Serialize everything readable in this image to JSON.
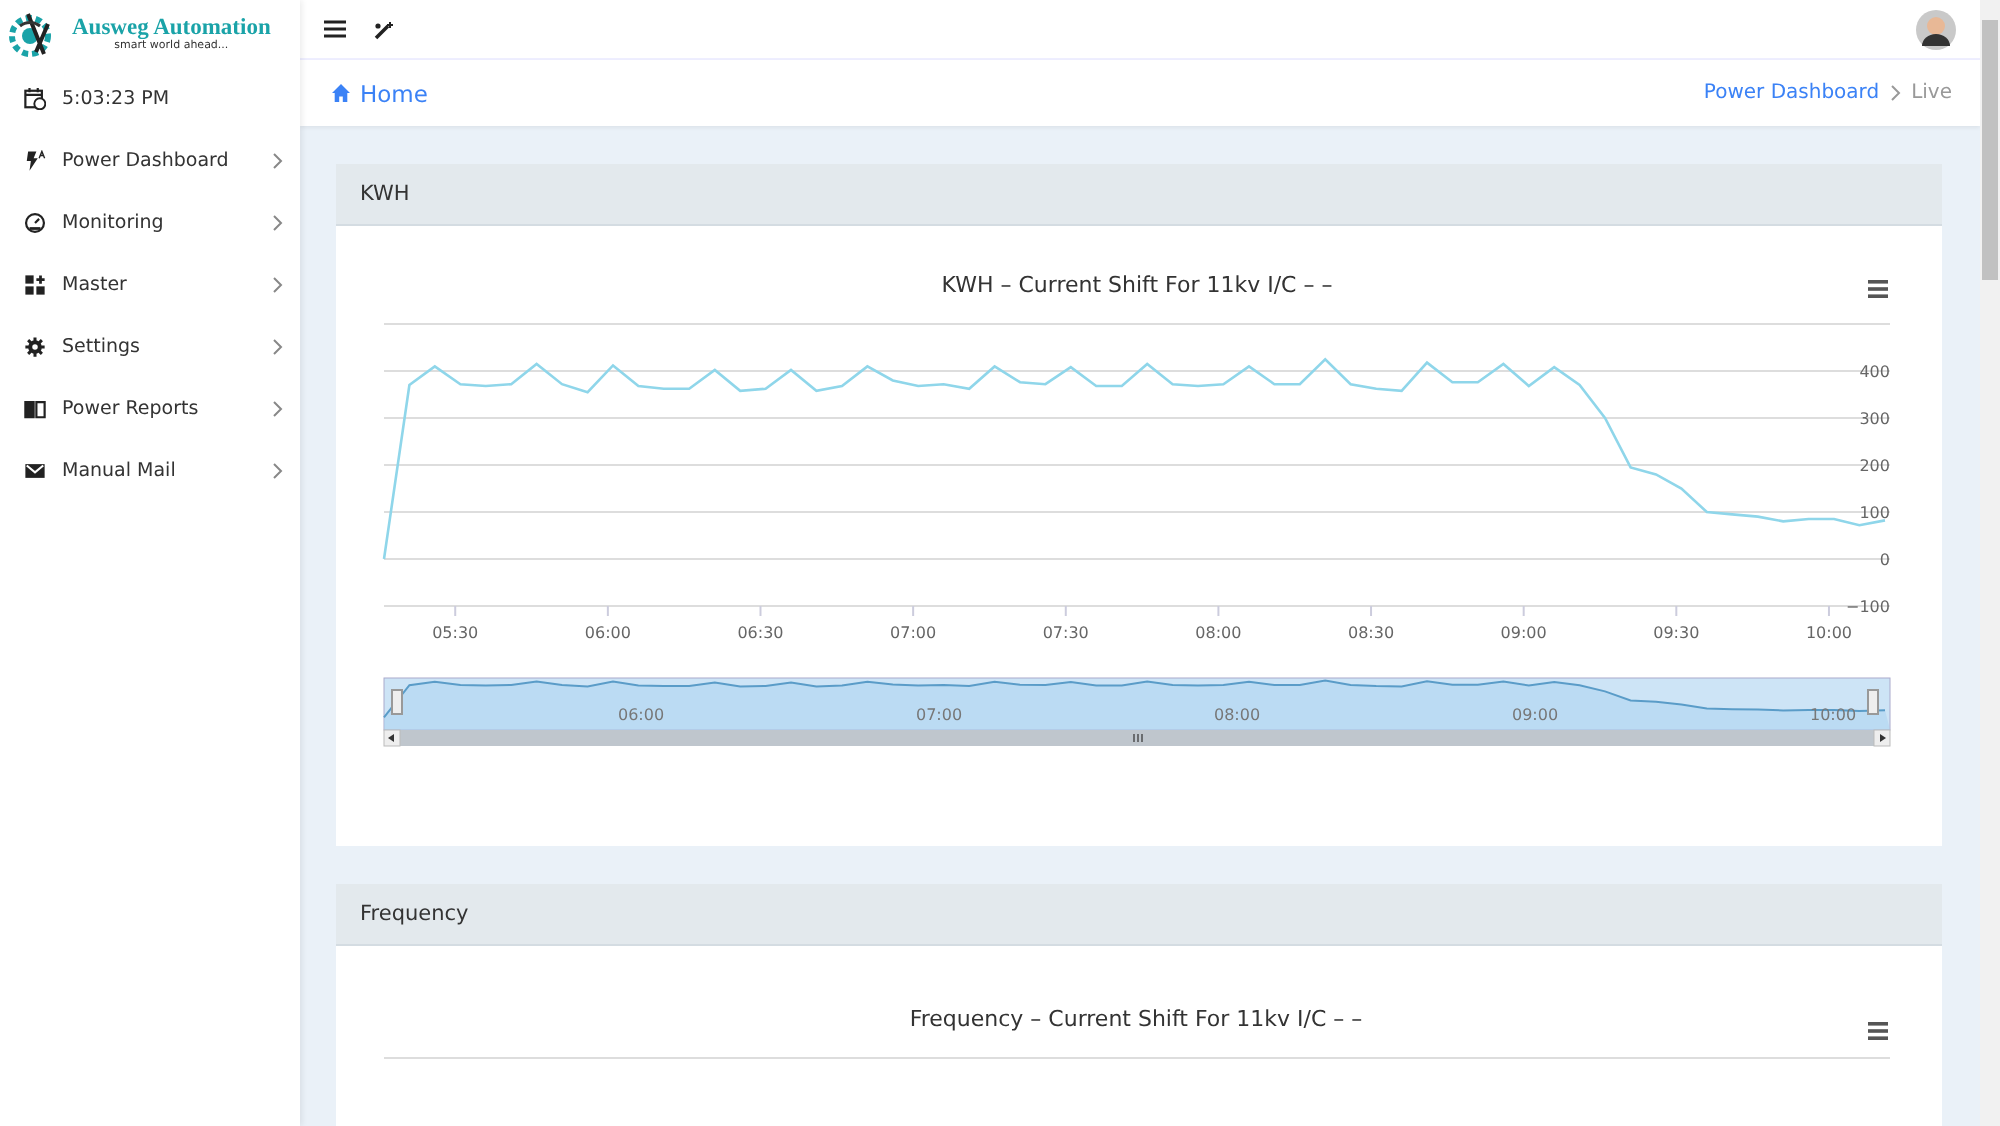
{
  "brand": {
    "name": "Ausweg Automation",
    "tagline": "smart world ahead..."
  },
  "sidebar": {
    "clock": "5:03:23 PM",
    "items": [
      {
        "label": "Power Dashboard"
      },
      {
        "label": "Monitoring"
      },
      {
        "label": "Master"
      },
      {
        "label": "Settings"
      },
      {
        "label": "Power Reports"
      },
      {
        "label": "Manual Mail"
      }
    ]
  },
  "breadcrumb": {
    "home": "Home",
    "trail": [
      "Power Dashboard",
      "Live"
    ]
  },
  "panels": [
    {
      "title": "KWH",
      "chart_data": {
        "type": "line",
        "title": "KWH – Current Shift For 11kv I/C – –",
        "x": [
          316,
          321,
          326,
          331,
          336,
          341,
          346,
          351,
          356,
          361,
          366,
          371,
          376,
          381,
          386,
          391,
          396,
          401,
          406,
          411,
          416,
          421,
          426,
          431,
          436,
          441,
          446,
          451,
          456,
          461,
          466,
          471,
          476,
          481,
          486,
          491,
          496,
          501,
          506,
          511,
          516,
          521,
          526,
          531,
          536,
          541,
          546,
          551,
          556,
          561,
          566,
          571,
          576,
          581,
          586,
          591,
          596,
          601,
          606,
          611
        ],
        "grid": true,
        "series": [
          {
            "color": "#8fd6ea",
            "values": [
              0,
              370,
              410,
              372,
              368,
              372,
              415,
              372,
              355,
              412,
              368,
              362,
              362,
              402,
              358,
              362,
              402,
              358,
              368,
              410,
              380,
              368,
              372,
              362,
              410,
              376,
              372,
              408,
              368,
              368,
              415,
              372,
              368,
              372,
              410,
              372,
              372,
              425,
              372,
              362,
              358,
              418,
              376,
              376,
              415,
              368,
              408,
              370,
              300,
              195,
              180,
              150,
              100,
              95,
              90,
              80,
              85,
              85,
              72,
              82
            ]
          }
        ],
        "xlim": [
          316,
          612
        ],
        "ylim": [
          -100,
          500
        ],
        "xticks": [
          {
            "value": 330,
            "label": "05:30"
          },
          {
            "value": 360,
            "label": "06:00"
          },
          {
            "value": 390,
            "label": "06:30"
          },
          {
            "value": 420,
            "label": "07:00"
          },
          {
            "value": 450,
            "label": "07:30"
          },
          {
            "value": 480,
            "label": "08:00"
          },
          {
            "value": 510,
            "label": "08:30"
          },
          {
            "value": 540,
            "label": "09:00"
          },
          {
            "value": 570,
            "label": "09:30"
          },
          {
            "value": 600,
            "label": "10:00"
          }
        ],
        "yticks": [
          {
            "value": -100,
            "label": "−100"
          },
          0,
          100,
          200,
          300,
          400
        ]
      },
      "navigator_labels": [
        "06:00",
        "07:00",
        "08:00",
        "09:00",
        "10:00"
      ]
    },
    {
      "title": "Frequency",
      "chart_title": "Frequency – Current Shift For 11kv I/C – –"
    }
  ]
}
